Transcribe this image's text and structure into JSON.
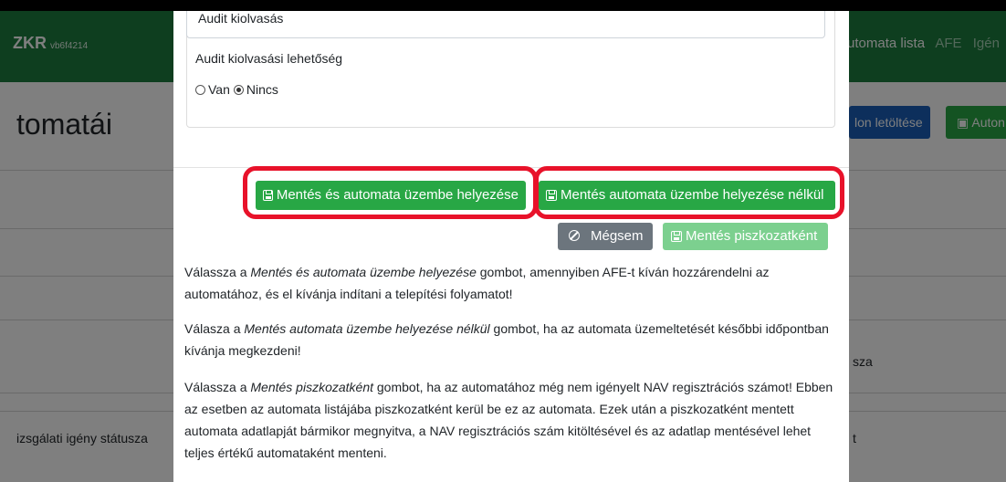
{
  "app": {
    "brand": "ZKR",
    "version": "vb6f4214",
    "nav": [
      {
        "label": "utomata lista",
        "active": true
      },
      {
        "label": "AFE",
        "active": false
      },
      {
        "label": "Igén",
        "active": false
      }
    ],
    "colors": {
      "navbar": "#1c7d3e",
      "green": "#28a745",
      "blue": "#1a5fb8",
      "highlight": "#e8122a"
    }
  },
  "background": {
    "page_title": "tomatái",
    "btn_download": "lon letöltése",
    "btn_auto": "Auton",
    "row_text_1": "izsgálati igény státusza",
    "row_text_2": "sza",
    "row_text_3": "t"
  },
  "modal": {
    "field_top_value": "Audit kiolvasás",
    "audit_label": "Audit kiolvasási lehetőség",
    "radio": {
      "yes": "Van",
      "no": "Nincs",
      "selected": "Nincs"
    },
    "buttons": {
      "save_deploy": "Mentés és automata üzembe helyezése",
      "save_no_deploy": "Mentés automata üzembe helyezése nélkül",
      "cancel": "Mégsem",
      "save_draft": "Mentés piszkozatként"
    },
    "info": {
      "p1_pre": "Válassza a ",
      "p1_em": "Mentés és automata üzembe helyezése",
      "p1_post": " gombot, amennyiben AFE-t kíván hozzárendelni az automatához, és el kívánja indítani a telepítési folyamatot!",
      "p2_pre": "Válasza a ",
      "p2_em": "Mentés automata üzembe helyezése nélkül",
      "p2_post": " gombot, ha az automata üzemeltetését későbbi időpontban kívánja megkezdeni!",
      "p3_pre": "Válassza a ",
      "p3_em": "Mentés piszkozatként",
      "p3_post": " gombot, ha az automatához még nem igényelt NAV regisztrációs számot! Ebben az esetben az automata listájába piszkozatként kerül be ez az automata. Ezek után a piszkozatként mentett automata adatlapját bármikor megnyitva, a NAV regisztrációs szám kitöltésével és az adatlap mentésével lehet teljes értékű automataként menteni."
    }
  }
}
